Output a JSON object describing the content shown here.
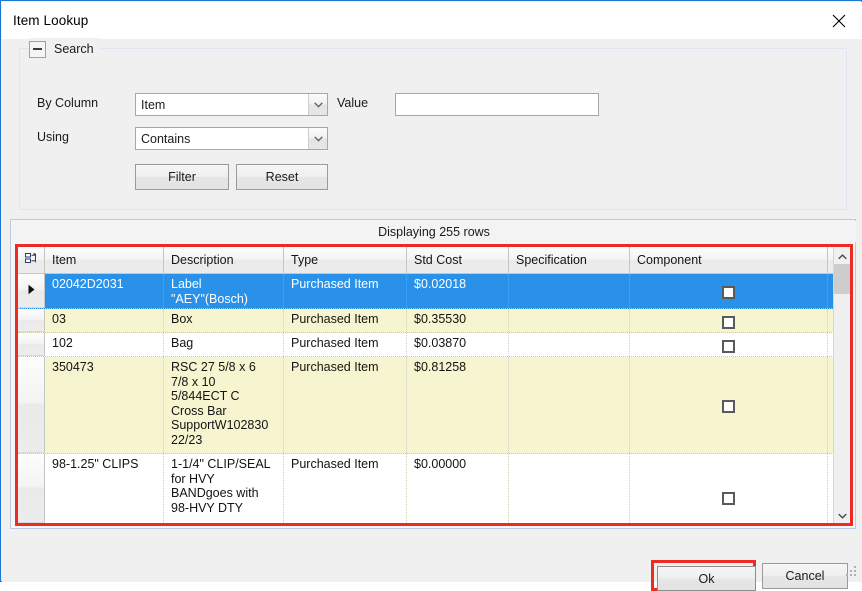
{
  "window": {
    "title": "Item Lookup",
    "close_icon": "close-icon"
  },
  "search": {
    "legend": "Search",
    "collapse_icon": "minus-icon",
    "by_column_label": "By Column",
    "by_column_value": "Item",
    "value_label": "Value",
    "value_text": "",
    "value_placeholder": "",
    "using_label": "Using",
    "using_value": "Contains",
    "filter_label": "Filter",
    "reset_label": "Reset"
  },
  "grid": {
    "status": "Displaying 255 rows",
    "sort_indicator": "sort-ascending-icon",
    "rowheader_icon": "select-all-icon",
    "current_row_icon": "current-row-arrow-icon",
    "columns": [
      "Item",
      "Description",
      "Type",
      "Std Cost",
      "Specification",
      "Component"
    ],
    "rows": [
      {
        "item": "02042D2031",
        "description": "Label\n\"AEY\"(Bosch)",
        "type": "Purchased Item",
        "std_cost": "$0.02018",
        "specification": "",
        "component": false,
        "state": "selected"
      },
      {
        "item": "03",
        "description": "Box",
        "type": "Purchased Item",
        "std_cost": "$0.35530",
        "specification": "",
        "component": false,
        "state": "alt"
      },
      {
        "item": "102",
        "description": "Bag",
        "type": "Purchased Item",
        "std_cost": "$0.03870",
        "specification": "",
        "component": false,
        "state": "plain"
      },
      {
        "item": "350473",
        "description": "RSC 27 5/8 x 6\n7/8 x 10\n5/844ECT C\nCross Bar\nSupportW102830\n22/23",
        "type": "Purchased Item",
        "std_cost": "$0.81258",
        "specification": "",
        "component": false,
        "state": "alt"
      },
      {
        "item": "98-1.25\" CLIPS",
        "description": "1-1/4\" CLIP/SEAL\nfor HVY\nBANDgoes with\n98-HVY DTY",
        "type": "Purchased Item",
        "std_cost": "$0.00000",
        "specification": "",
        "component": false,
        "state": "plain"
      }
    ],
    "scrollbar": {
      "up_icon": "chevron-up-icon",
      "down_icon": "chevron-down-icon"
    }
  },
  "footer": {
    "ok_label": "Ok",
    "cancel_label": "Cancel",
    "grip_icon": "resize-grip-icon"
  },
  "colors": {
    "accent_border": "#1c78d4",
    "selection": "#2a91e8",
    "alt_row": "#f7f4d0",
    "focus_red": "#ee2a24"
  }
}
